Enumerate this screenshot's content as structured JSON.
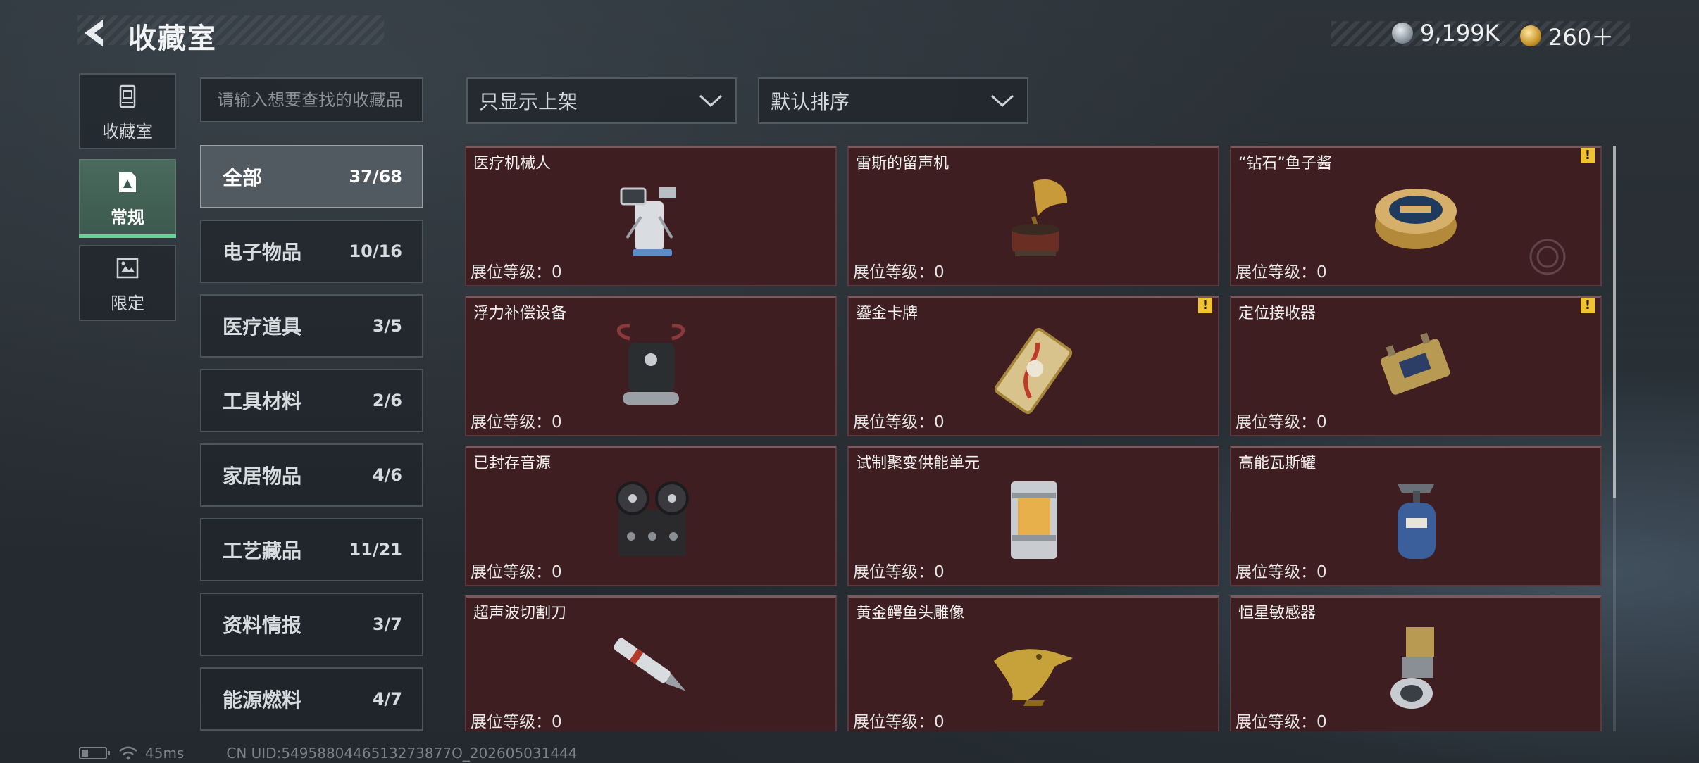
{
  "header": {
    "title": "收藏室"
  },
  "currency": {
    "silver": "9,199K",
    "gold": "260＋"
  },
  "side_tabs": [
    {
      "label": "收藏室",
      "icon": "display-case-icon"
    },
    {
      "label": "常规",
      "icon": "regular-collection-icon"
    },
    {
      "label": "限定",
      "icon": "limited-collection-icon"
    }
  ],
  "search": {
    "placeholder": "请输入想要查找的收藏品"
  },
  "categories": [
    {
      "name": "全部",
      "count": "37/68"
    },
    {
      "name": "电子物品",
      "count": "10/16"
    },
    {
      "name": "医疗道具",
      "count": "3/5"
    },
    {
      "name": "工具材料",
      "count": "2/6"
    },
    {
      "name": "家居物品",
      "count": "4/6"
    },
    {
      "name": "工艺藏品",
      "count": "11/21"
    },
    {
      "name": "资料情报",
      "count": "3/7"
    },
    {
      "name": "能源燃料",
      "count": "4/7"
    }
  ],
  "filters": {
    "display": "只显示上架",
    "sort": "默认排序"
  },
  "items": [
    {
      "title": "医疗机械人",
      "level": "展位等级：0",
      "icon": "medical-robot-icon",
      "alert": false
    },
    {
      "title": "雷斯的留声机",
      "level": "展位等级：0",
      "icon": "gramophone-icon",
      "alert": false
    },
    {
      "title": "“钻石”鱼子酱",
      "level": "展位等级：0",
      "icon": "caviar-tin-icon",
      "alert": true
    },
    {
      "title": "浮力补偿设备",
      "level": "展位等级：0",
      "icon": "buoyancy-device-icon",
      "alert": false
    },
    {
      "title": "鎏金卡牌",
      "level": "展位等级：0",
      "icon": "gilded-card-icon",
      "alert": true
    },
    {
      "title": "定位接收器",
      "level": "展位等级：0",
      "icon": "locator-receiver-icon",
      "alert": true
    },
    {
      "title": "已封存音源",
      "level": "展位等级：0",
      "icon": "reel-recorder-icon",
      "alert": false
    },
    {
      "title": "试制聚变供能单元",
      "level": "展位等级：0",
      "icon": "fusion-cell-icon",
      "alert": false
    },
    {
      "title": "高能瓦斯罐",
      "level": "展位等级：0",
      "icon": "gas-canister-icon",
      "alert": false
    },
    {
      "title": "超声波切割刀",
      "level": "展位等级：0",
      "icon": "ultrasonic-cutter-icon",
      "alert": false
    },
    {
      "title": "黄金鳄鱼头雕像",
      "level": "展位等级：0",
      "icon": "gold-crocodile-icon",
      "alert": false
    },
    {
      "title": "恒星敏感器",
      "level": "展位等级：0",
      "icon": "star-sensor-icon",
      "alert": false
    }
  ],
  "alert_mark": "!",
  "footer": {
    "ping": "45ms",
    "uid": "CN UID:5495880446513273877O_202605031444"
  },
  "colors": {
    "card_bg": "#3f1e21",
    "active_tab": "#3c5a4e",
    "accent_green": "#66d39a",
    "alert_yellow": "#f1c330"
  }
}
